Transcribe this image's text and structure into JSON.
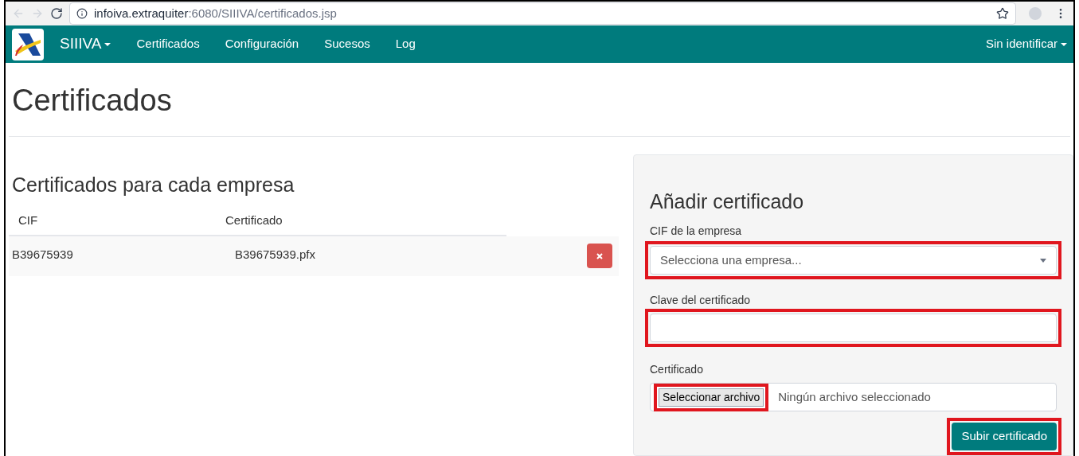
{
  "browser": {
    "url_host": "infoiva.extraquiter",
    "url_path": ":6080/SIIIVA/certificados.jsp"
  },
  "navbar": {
    "brand": "SIIIVA",
    "items": [
      {
        "label": "Certificados"
      },
      {
        "label": "Configuración"
      },
      {
        "label": "Sucesos"
      },
      {
        "label": "Log"
      }
    ],
    "user": "Sin identificar"
  },
  "page_title": "Certificados",
  "list": {
    "title": "Certificados para cada empresa",
    "columns": [
      "CIF",
      "Certificado"
    ],
    "rows": [
      {
        "cif": "B39675939",
        "certificate": "B39675939.pfx"
      }
    ]
  },
  "form": {
    "title": "Añadir certificado",
    "company": {
      "label": "CIF de la empresa",
      "placeholder": "Selecciona una empresa...",
      "highlighted": true
    },
    "password": {
      "label": "Clave del certificado",
      "highlighted": true
    },
    "file": {
      "label": "Certificado",
      "button": "Seleccionar archivo",
      "status": "Ningún archivo seleccionado",
      "highlighted": true
    },
    "submit": {
      "label": "Subir certificado",
      "highlighted": true
    }
  }
}
